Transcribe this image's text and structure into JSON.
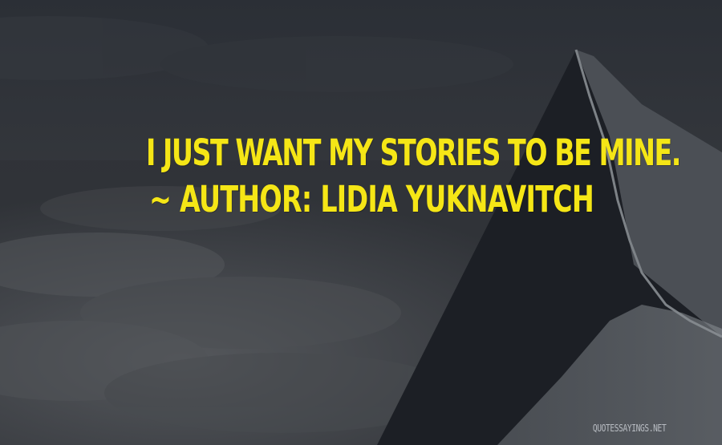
{
  "quote": {
    "text": "I JUST WANT MY STORIES TO BE MINE.",
    "author_line": "~ AUTHOR: LIDIA YUKNAVITCH"
  },
  "watermark": {
    "text": "QUOTESSAYINGS.NET"
  },
  "colors": {
    "text": "#f5e616",
    "background": "#2c3036",
    "mountain": "#1c1f25"
  }
}
